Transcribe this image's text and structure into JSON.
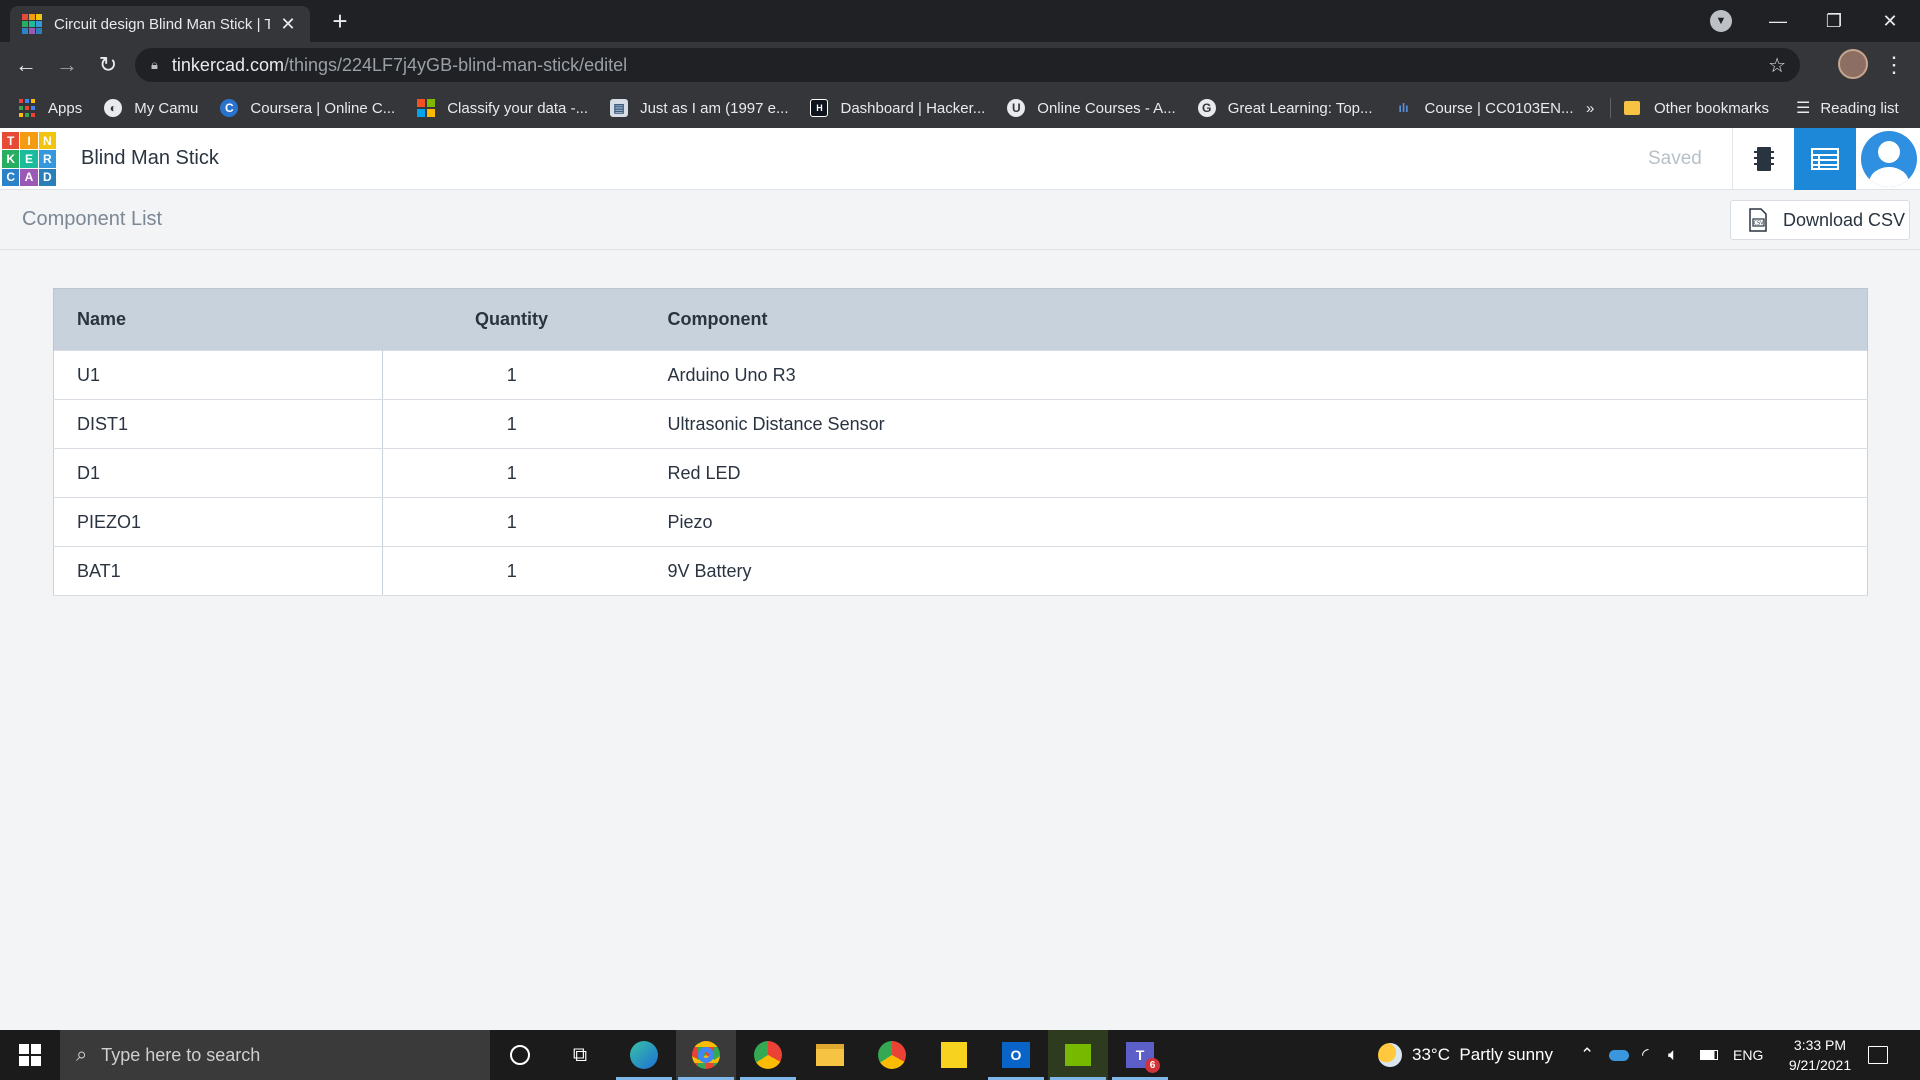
{
  "browser": {
    "tab_title": "Circuit design Blind Man Stick | Ti",
    "tab_close": "✕",
    "new_tab": "+",
    "url_host": "tinkercad.com",
    "url_path": "/things/224LF7j4yGB-blind-man-stick/editel"
  },
  "bookmarks": {
    "items": [
      {
        "label": "Apps",
        "icon": "apps-grid-icon"
      },
      {
        "label": "My Camu",
        "icon": "camu-icon"
      },
      {
        "label": "Coursera | Online C...",
        "icon": "coursera-icon"
      },
      {
        "label": "Classify your data -...",
        "icon": "microsoft-icon"
      },
      {
        "label": "Just as I am (1997 e...",
        "icon": "book-icon"
      },
      {
        "label": "Dashboard | Hacker...",
        "icon": "hackerrank-icon"
      },
      {
        "label": "Online Courses - A...",
        "icon": "online-courses-icon"
      },
      {
        "label": "Great Learning: Top...",
        "icon": "great-learning-icon"
      },
      {
        "label": "Course | CC0103EN...",
        "icon": "course-icon"
      }
    ],
    "overflow": "»",
    "other_bookmarks": "Other bookmarks",
    "reading_list": "Reading list"
  },
  "app": {
    "logo_letters": [
      "T",
      "I",
      "N",
      "K",
      "E",
      "R",
      "C",
      "A",
      "D"
    ],
    "design_name": "Blind Man Stick",
    "saved_status": "Saved",
    "page_title": "Component List",
    "download_csv": "Download CSV"
  },
  "table": {
    "headers": {
      "name": "Name",
      "quantity": "Quantity",
      "component": "Component"
    },
    "rows": [
      {
        "name": "U1",
        "quantity": "1",
        "component": "Arduino Uno R3"
      },
      {
        "name": "DIST1",
        "quantity": "1",
        "component": "Ultrasonic Distance Sensor"
      },
      {
        "name": "D1",
        "quantity": "1",
        "component": "Red LED"
      },
      {
        "name": "PIEZO1",
        "quantity": "1",
        "component": "Piezo"
      },
      {
        "name": "BAT1",
        "quantity": "1",
        "component": "9V Battery"
      }
    ]
  },
  "taskbar": {
    "search_placeholder": "Type here to search",
    "weather": "33°C  Partly sunny",
    "language": "ENG",
    "time": "3:33 PM",
    "date": "9/21/2021",
    "teams_badge": "6"
  },
  "colors": {
    "accent": "#1e88d8",
    "header_row": "#c7d2dc",
    "logo": [
      "#e54b37",
      "#f39c12",
      "#f1c40f",
      "#27ae60",
      "#1abc9c",
      "#3498db",
      "#2c82c9",
      "#9b59b6",
      "#2980b9"
    ]
  }
}
